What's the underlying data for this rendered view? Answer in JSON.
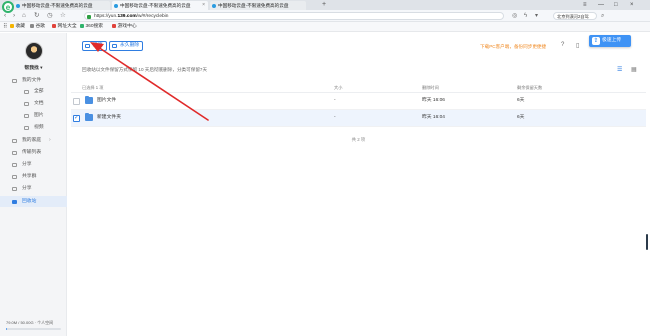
{
  "browser": {
    "tabs": [
      {
        "title": "中国移动云盘-不限速免费高的云盘"
      },
      {
        "title": "中国移动云盘-不限速免费高的云盘"
      },
      {
        "title": "中国移动云盘-不限速免费高的云盘"
      }
    ],
    "url_prefix": "https://yun.",
    "url_domain": "139.com",
    "url_suffix": "/w/#/recyclebin",
    "search_text": "北京到漠河2自驾",
    "bookmarks": [
      "收藏",
      "谷歌",
      "网址大全",
      "360搜索",
      "游戏中心"
    ]
  },
  "sidebar": {
    "username": "帮我找",
    "items": [
      {
        "label": "我的文件"
      },
      {
        "label": "全部"
      },
      {
        "label": "文档"
      },
      {
        "label": "图片"
      },
      {
        "label": "视频"
      },
      {
        "label": "我的家庭"
      },
      {
        "label": "传输列表"
      },
      {
        "label": "分享"
      },
      {
        "label": "共享群"
      },
      {
        "label": "分享"
      },
      {
        "label": "回收站"
      }
    ],
    "storage": "79.0M / 50.00G  · 个人空间",
    "storage_used_fraction": 0.02
  },
  "toolbar": {
    "restore_label": "还原",
    "delete_label": "永久删除",
    "promo": "下载PC客户端，备份同步更便捷",
    "upload_label": "极速上传"
  },
  "notice": "回收站以文件保留方式保留 10 天后彻底删除，分类可保留7天",
  "table": {
    "headers": [
      "已选择 1 项",
      "大小",
      "删除时间",
      "剩余保留天数"
    ],
    "rows": [
      {
        "name": "图片文件",
        "size": "-",
        "time": "昨天 16:06",
        "days": "6天",
        "selected": false
      },
      {
        "name": "新建文件夹",
        "size": "-",
        "time": "昨天 16:04",
        "days": "6天",
        "selected": true
      }
    ],
    "page_info": "共 2 项"
  },
  "colors": {
    "accent": "#2f7de1",
    "promo": "#f08a24",
    "annotation": "#e02a2a"
  }
}
